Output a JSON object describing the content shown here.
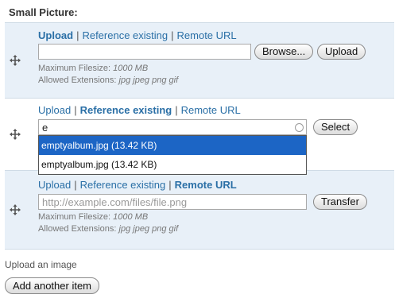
{
  "field": {
    "title": "Small Picture:"
  },
  "rows": [
    {
      "links": {
        "upload": "Upload",
        "reference": "Reference existing",
        "remote": "Remote URL",
        "separator": "|"
      },
      "input_value": "",
      "browse_label": "Browse...",
      "upload_label": "Upload",
      "max_filesize_label": "Maximum Filesize:",
      "max_filesize_value": "1000 MB",
      "allowed_ext_label": "Allowed Extensions:",
      "allowed_ext_value": "jpg jpeg png gif"
    },
    {
      "links": {
        "upload": "Upload",
        "reference": "Reference existing",
        "remote": "Remote URL",
        "separator": "|"
      },
      "input_value": "e",
      "select_label": "Select",
      "autocomplete": [
        "emptyalbum.jpg (13.42 KB)",
        "emptyalbum.jpg (13.42 KB)"
      ]
    },
    {
      "links": {
        "upload": "Upload",
        "reference": "Reference existing",
        "remote": "Remote URL",
        "separator": "|"
      },
      "input_placeholder": "http://example.com/files/file.png",
      "transfer_label": "Transfer",
      "max_filesize_label": "Maximum Filesize:",
      "max_filesize_value": "1000 MB",
      "allowed_ext_label": "Allowed Extensions:",
      "allowed_ext_value": "jpg jpeg png gif"
    }
  ],
  "footer": {
    "help_text": "Upload an image",
    "add_label": "Add another item"
  },
  "icons": {
    "drag": "move-arrows-icon",
    "search": "search-circle-icon"
  },
  "colors": {
    "link": "#2a6fa6",
    "row_stripe": "#e8f0f8",
    "row_border": "#cfdbe6",
    "autocomplete_selected": "#1c65c5"
  }
}
